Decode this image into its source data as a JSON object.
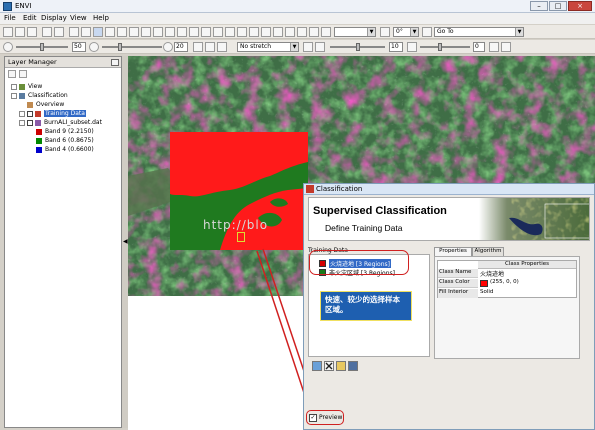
{
  "app": {
    "title": "ENVI"
  },
  "menu": {
    "items": [
      "File",
      "Edit",
      "Display",
      "View",
      "Help"
    ]
  },
  "toolbar1": {
    "zoom_value": "0°",
    "goto_value": "Go To"
  },
  "toolbar2": {
    "slider1_value": "50",
    "slider2_value": "20",
    "stretch_value": "No stretch",
    "slider3_value": "10",
    "slider4_value": "0"
  },
  "layer_manager": {
    "title": "Layer Manager",
    "tree": [
      {
        "label": "View"
      },
      {
        "label": "Classification"
      },
      {
        "label": "Overview"
      },
      {
        "label": "Training Data"
      },
      {
        "label": "BurnALI_subset.dat"
      },
      {
        "label": "Band 9 (2.2150)",
        "color": "#cc0000"
      },
      {
        "label": "Band 6 (0.8675)",
        "color": "#008800"
      },
      {
        "label": "Band 4 (0.6600)",
        "color": "#0000cc"
      }
    ]
  },
  "watermark": {
    "text": "http://blo"
  },
  "dialog": {
    "title": "Classification",
    "banner_title": "Supervised Classification",
    "banner_subtitle": "Define Training Data",
    "training_data_label": "Training Data",
    "classes": [
      {
        "name": "火烧迹地 [3 Regions]",
        "color": "#d40000"
      },
      {
        "name": "非火灾区域 [3 Regions]",
        "color": "#1a7a1a"
      }
    ],
    "annotation": "快速、较少的选择样本区域。",
    "tabs": [
      "Properties",
      "Algorithm"
    ],
    "props_header": "Class Properties",
    "props": [
      {
        "key": "Class Name",
        "value": "火烧迹地"
      },
      {
        "key": "Class Color",
        "value": "(255, 0, 0)",
        "swatch": "#ff0000"
      },
      {
        "key": "Fill Interior",
        "value": "Solid"
      }
    ],
    "preview_label": "Preview",
    "preview_checked": true
  },
  "colors": {
    "highlight": "#d02020",
    "callout_bg": "#1e5fb0"
  }
}
